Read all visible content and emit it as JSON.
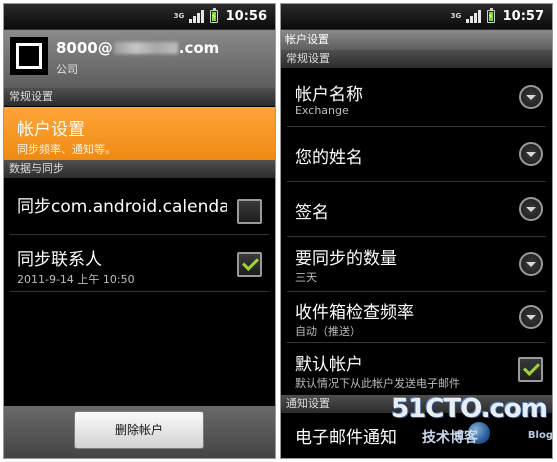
{
  "left": {
    "status": {
      "network": "3G",
      "time": "10:56"
    },
    "account": {
      "email_prefix": "8000@",
      "email_suffix": ".com",
      "subtitle": "公司"
    },
    "section_general": "常规设置",
    "account_settings": {
      "title": "帐户设置",
      "summary": "同步频率、通知等。"
    },
    "section_data_sync": "数据与同步",
    "sync_calendar": {
      "title": "同步com.android.calendar",
      "checked": false
    },
    "sync_contacts": {
      "title": "同步联系人",
      "summary": "2011-9-14 上午 10:50",
      "checked": true
    },
    "delete_button": "删除帐户"
  },
  "right": {
    "status": {
      "network": "3G",
      "time": "10:57"
    },
    "title": "帐户设置",
    "section_general": "常规设置",
    "items": [
      {
        "title": "帐户名称",
        "summary": "Exchange"
      },
      {
        "title": "您的姓名",
        "summary": ""
      },
      {
        "title": "签名",
        "summary": ""
      },
      {
        "title": "要同步的数量",
        "summary": "三天"
      },
      {
        "title": "收件箱检查频率",
        "summary": "自动（推送）"
      }
    ],
    "default_account": {
      "title": "默认帐户",
      "summary": "默认情况下从此帐户发送电子邮件",
      "checked": true
    },
    "section_notifications": "通知设置",
    "email_notify": {
      "title": "电子邮件通知"
    }
  },
  "watermark": {
    "main": "51CTO.com",
    "sub": "技术博客",
    "site": "Blog"
  },
  "colors": {
    "highlight": "#f39216",
    "check": "#9bd33a"
  }
}
